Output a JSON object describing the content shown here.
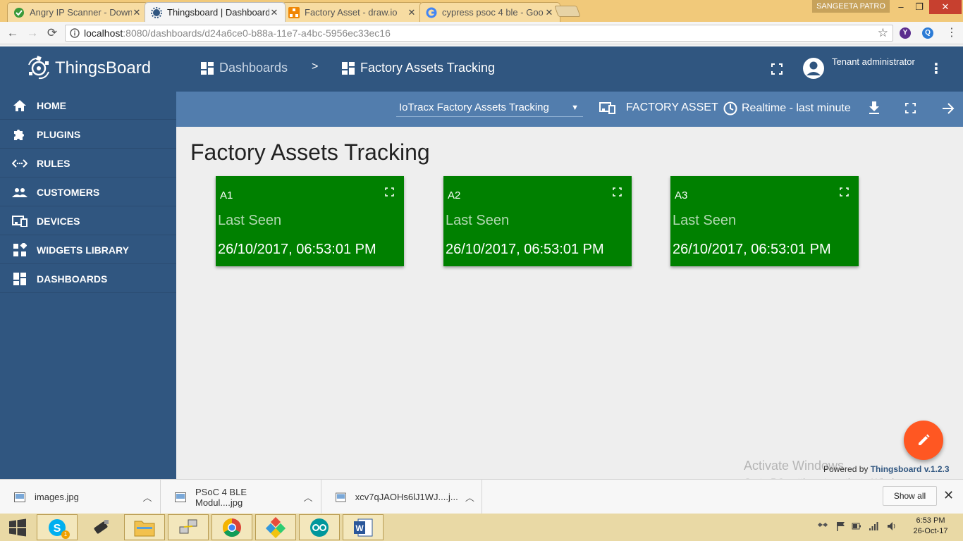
{
  "browser": {
    "tabs": [
      {
        "title": "Angry IP Scanner - Down",
        "active": false
      },
      {
        "title": "Thingsboard | Dashboard",
        "active": true
      },
      {
        "title": "Factory Asset - draw.io",
        "active": false
      },
      {
        "title": "cypress psoc 4 ble - Goo",
        "active": false
      }
    ],
    "user_chip": "SANGEETA PATRO",
    "address": {
      "host": "localhost",
      "path": ":8080/dashboards/d24a6ce0-b88a-11e7-a4bc-5956ec33ec16"
    },
    "extensions": [
      {
        "letter": "Y",
        "color": "#5b2d8e"
      },
      {
        "letter": "Q",
        "color": "#2b7bd6"
      }
    ]
  },
  "app": {
    "logo_text": "ThingsBoard",
    "breadcrumb": {
      "root": "Dashboards",
      "separator": ">",
      "current": "Factory Assets Tracking"
    },
    "user": {
      "role": "Tenant administrator"
    },
    "sidebar": {
      "items": [
        {
          "label": "HOME",
          "icon": "home-icon"
        },
        {
          "label": "PLUGINS",
          "icon": "puzzle-icon"
        },
        {
          "label": "RULES",
          "icon": "code-arrows-icon"
        },
        {
          "label": "CUSTOMERS",
          "icon": "people-icon"
        },
        {
          "label": "DEVICES",
          "icon": "devices-icon"
        },
        {
          "label": "WIDGETS LIBRARY",
          "icon": "widgets-icon"
        },
        {
          "label": "DASHBOARDS",
          "icon": "dashboard-icon"
        }
      ]
    },
    "dashboard_bar": {
      "state_select": "IoTracx Factory Assets Tracking",
      "entity_alias": "FACTORY ASSET",
      "timewindow": "Realtime - last minute"
    },
    "dashboard": {
      "title": "Factory Assets Tracking",
      "cards": [
        {
          "name": "A1",
          "label": "Last Seen",
          "value": "26/10/2017, 06:53:01 PM"
        },
        {
          "name": "A2",
          "label": "Last Seen",
          "value": "26/10/2017, 06:53:01 PM"
        },
        {
          "name": "A3",
          "label": "Last Seen",
          "value": "26/10/2017, 06:53:01 PM"
        }
      ],
      "card_color": "#008000"
    },
    "powered_by": {
      "prefix": "Powered by",
      "link": "Thingsboard v.1.2.3"
    },
    "watermark": {
      "line1": "Activate Windows",
      "line2": "Go to PC settings to activate Windows."
    },
    "accent": "#305680",
    "fab_color": "#ff5722"
  },
  "downloads": {
    "items": [
      "images.jpg",
      "PSoC 4 BLE Modul....jpg",
      "xcv7qJAOHs6lJ1WJ....j..."
    ],
    "show_all": "Show all"
  },
  "taskbar": {
    "time": "6:53 PM",
    "date": "26-Oct-17",
    "skype_badge": "1"
  }
}
